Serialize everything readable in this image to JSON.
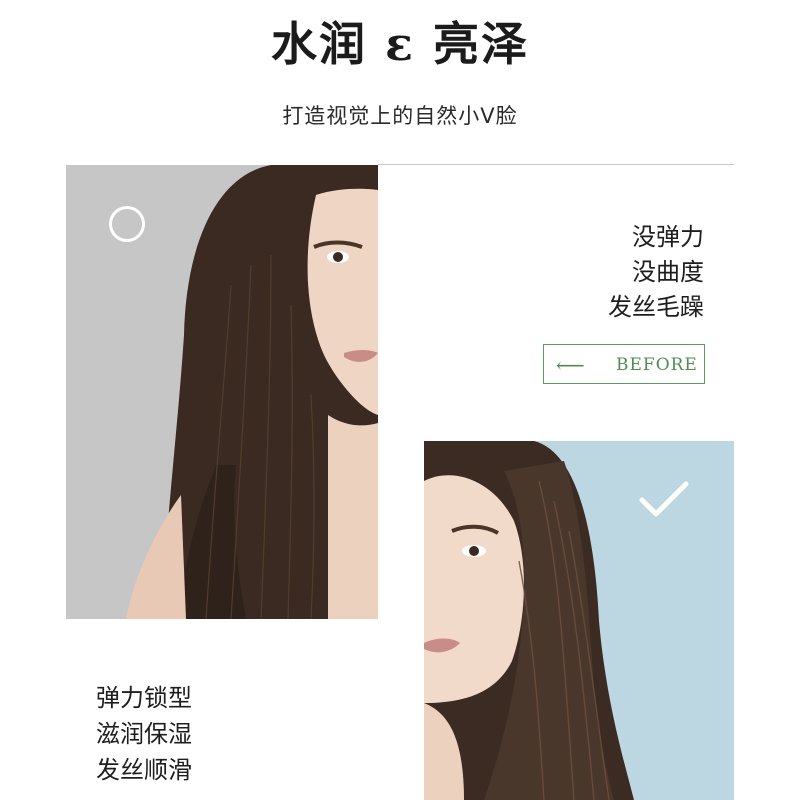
{
  "header": {
    "title": "水润 ε 亮泽",
    "subtitle": "打造视觉上的自然小V脸"
  },
  "before": {
    "mark_icon": "circle-icon",
    "lines": [
      "没弹力",
      "没曲度",
      "发丝毛躁"
    ],
    "tag": {
      "arrow": "⟵",
      "label": "BEFORE"
    }
  },
  "after": {
    "mark_icon": "check-icon",
    "lines": [
      "弹力锁型",
      "滋润保湿",
      "发丝顺滑"
    ]
  },
  "colors": {
    "before_bg": "#c6c6c6",
    "after_bg": "#bcd7e2",
    "tag_green": "#5e9a63",
    "hair": "#3b2a20"
  }
}
